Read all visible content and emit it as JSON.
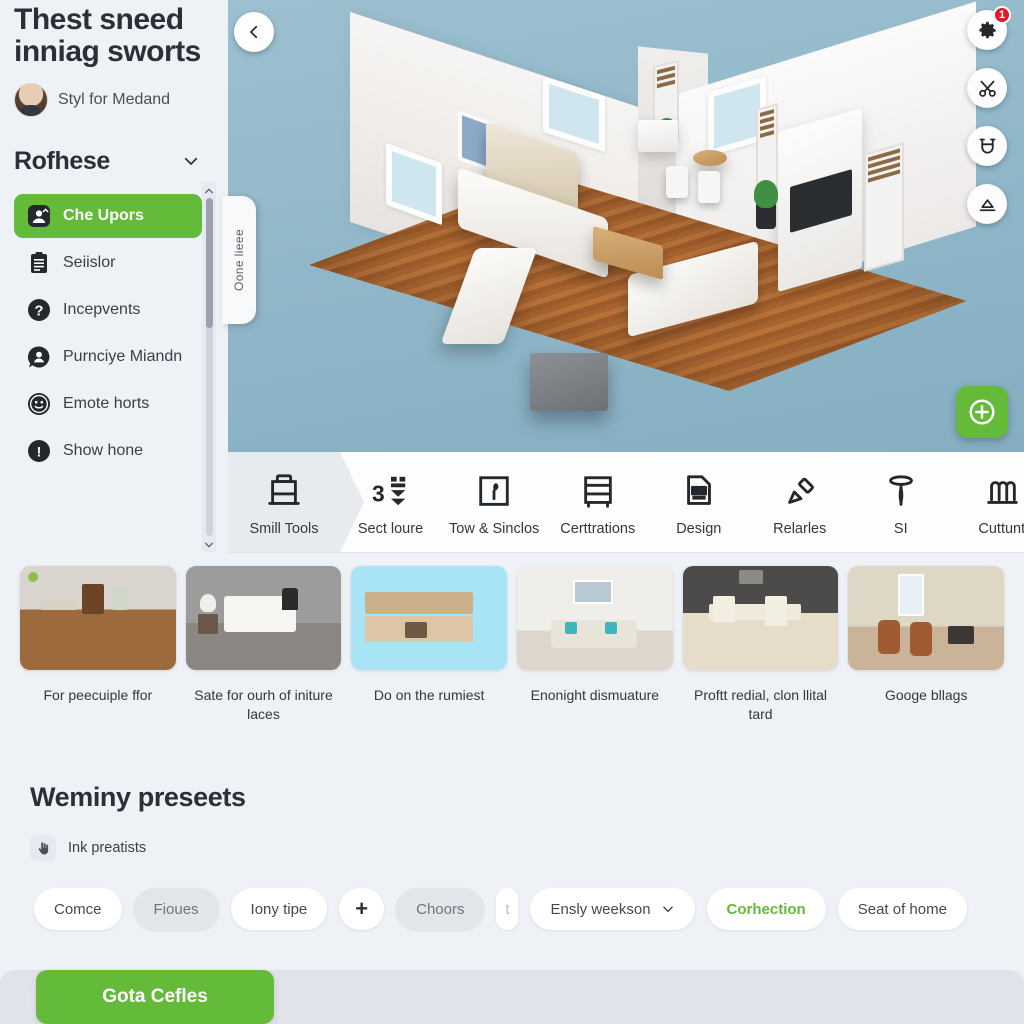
{
  "sidebar": {
    "title": "Thest sneed inniag sworts",
    "user": {
      "name": "Styl for Medand",
      "avatar_icon": "avatar"
    },
    "section": {
      "label": "Rofhese",
      "chevron_icon": "chevron-down-icon"
    },
    "items": [
      {
        "label": "Che Upors",
        "icon": "user-upload-icon",
        "active": true
      },
      {
        "label": "Seiislor",
        "icon": "clipboard-icon",
        "active": false
      },
      {
        "label": "Incepvents",
        "icon": "question-circle-icon",
        "active": false
      },
      {
        "label": "Purnciye Miandn",
        "icon": "chat-user-icon",
        "active": false
      },
      {
        "label": "Emote horts",
        "icon": "face-circle-icon",
        "active": false
      },
      {
        "label": "Show hone",
        "icon": "info-circle-icon",
        "active": false
      }
    ],
    "scrollbar": {
      "up_icon": "chevron-up-icon",
      "down_icon": "chevron-down-icon"
    }
  },
  "viewport": {
    "back_icon": "chevron-left-icon",
    "side_tab_label": "Oone lieee",
    "tools": [
      {
        "icon": "gear-icon",
        "badge": "1"
      },
      {
        "icon": "scissors-icon",
        "badge": ""
      },
      {
        "icon": "magnet-icon",
        "badge": ""
      },
      {
        "icon": "lamp-icon",
        "badge": ""
      }
    ],
    "add_icon": "plus-circle-icon"
  },
  "toolbar": {
    "categories": [
      {
        "label": "Smill Tools",
        "icon": "table-icon",
        "selected": true
      },
      {
        "label": "Sect loure",
        "icon": "sort-layers-icon",
        "selected": false
      },
      {
        "label": "Tow & Sinclos",
        "icon": "window-plant-icon",
        "selected": false
      },
      {
        "label": "Certtrations",
        "icon": "drawer-icon",
        "selected": false
      },
      {
        "label": "Design",
        "icon": "sofa-plan-icon",
        "selected": false
      },
      {
        "label": "Relarles",
        "icon": "paint-roller-icon",
        "selected": false
      },
      {
        "label": "SI",
        "icon": "lamp-floor-icon",
        "selected": false
      },
      {
        "label": "Cuttunt",
        "icon": "radiator-icon",
        "selected": false
      }
    ]
  },
  "gallery": {
    "cards": [
      {
        "caption": "For peecuiple ffor",
        "thumb": "room-floor-thumb"
      },
      {
        "caption": "Sate for ourh of initure laces",
        "thumb": "bedroom-thumb"
      },
      {
        "caption": "Do on the rumiest",
        "thumb": "sideboard-thumb"
      },
      {
        "caption": "Enonight dismuature",
        "thumb": "living-sofa-thumb"
      },
      {
        "caption": "Proftt redial, clon llital tard",
        "thumb": "dining-set-thumb"
      },
      {
        "caption": "Googe bllags",
        "thumb": "dining-room-thumb"
      }
    ]
  },
  "presets": {
    "title": "Weminy preseets",
    "sub_label": "Ink preatists",
    "sub_icon": "hand-click-icon",
    "chips": [
      {
        "label": "Comce",
        "style": "plain"
      },
      {
        "label": "Fioues",
        "style": "muted"
      },
      {
        "label": "Iony tipe",
        "style": "plain"
      },
      {
        "label": "+",
        "style": "plus"
      },
      {
        "label": "Choors",
        "style": "muted"
      },
      {
        "label": "t",
        "style": "ghost"
      },
      {
        "label": "Ensly weekson",
        "style": "dropdown",
        "dropdown_icon": "chevron-down-icon"
      },
      {
        "label": "Corhection",
        "style": "accent"
      },
      {
        "label": "Seat of home",
        "style": "plain"
      }
    ]
  },
  "footer": {
    "cta_label": "Gota Cefles"
  },
  "colors": {
    "accent_green": "#63bb39",
    "badge_red": "#e11b22",
    "page_bg": "#eef1f6",
    "viewport_bg": "#8fb6c8",
    "text_dark": "#2b3036"
  }
}
